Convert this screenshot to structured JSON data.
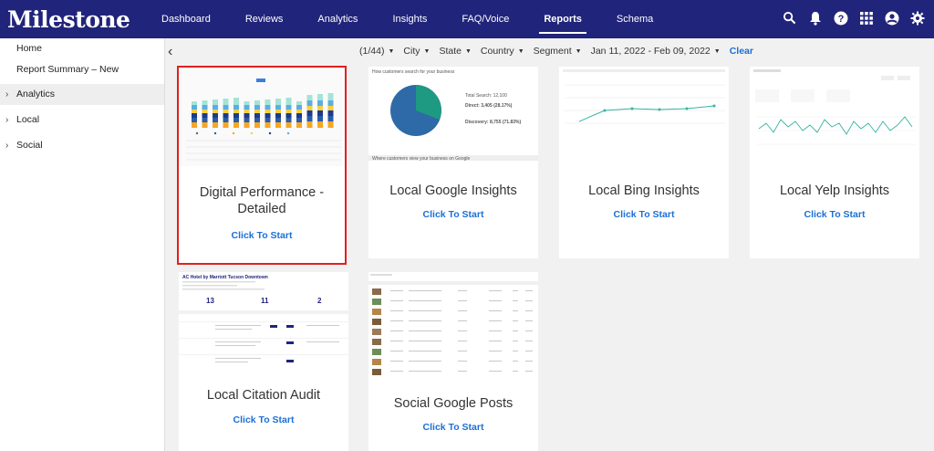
{
  "app": {
    "logo": "Milestone"
  },
  "nav": [
    {
      "label": "Dashboard"
    },
    {
      "label": "Reviews"
    },
    {
      "label": "Analytics"
    },
    {
      "label": "Insights"
    },
    {
      "label": "FAQ/Voice"
    },
    {
      "label": "Reports",
      "active": true
    },
    {
      "label": "Schema"
    }
  ],
  "top_icons": [
    "search-icon",
    "bell-icon",
    "help-icon",
    "grid-icon",
    "account-icon",
    "gear-icon"
  ],
  "sidebar": {
    "items": [
      {
        "label": "Home"
      },
      {
        "label": "Report Summary – New"
      },
      {
        "label": "Analytics",
        "expandable": true,
        "selected": true
      },
      {
        "label": "Local",
        "expandable": true
      },
      {
        "label": "Social",
        "expandable": true
      }
    ]
  },
  "filters": {
    "location": "(1/44)",
    "city": "City",
    "state": "State",
    "country": "Country",
    "segment": "Segment",
    "date_range": "Jan 11, 2022 - Feb 09, 2022",
    "clear": "Clear"
  },
  "cards": [
    {
      "title": "Digital Performance - Detailed",
      "cta": "Click To Start",
      "selected": true
    },
    {
      "title": "Local Google Insights",
      "cta": "Click To Start"
    },
    {
      "title": "Local Bing Insights",
      "cta": "Click To Start"
    },
    {
      "title": "Local Yelp Insights",
      "cta": "Click To Start"
    },
    {
      "title": "Local Citation Audit",
      "cta": "Click To Start"
    },
    {
      "title": "Social Google Posts",
      "cta": "Click To Start"
    }
  ],
  "thumbnails": {
    "google": {
      "heading": "How customers search for your business",
      "total": "Total Search: 12,100",
      "direct": "Direct: 3,405 (28.17%)",
      "discovery": "Discovery: 8,755 (71.83%)",
      "footer": "Where customers view your business on Google"
    },
    "citation": {
      "heading": "AC Hotel by Marriott Tucson Downtown",
      "stats": [
        {
          "value": "13"
        },
        {
          "value": "11"
        },
        {
          "value": "2"
        }
      ]
    }
  }
}
